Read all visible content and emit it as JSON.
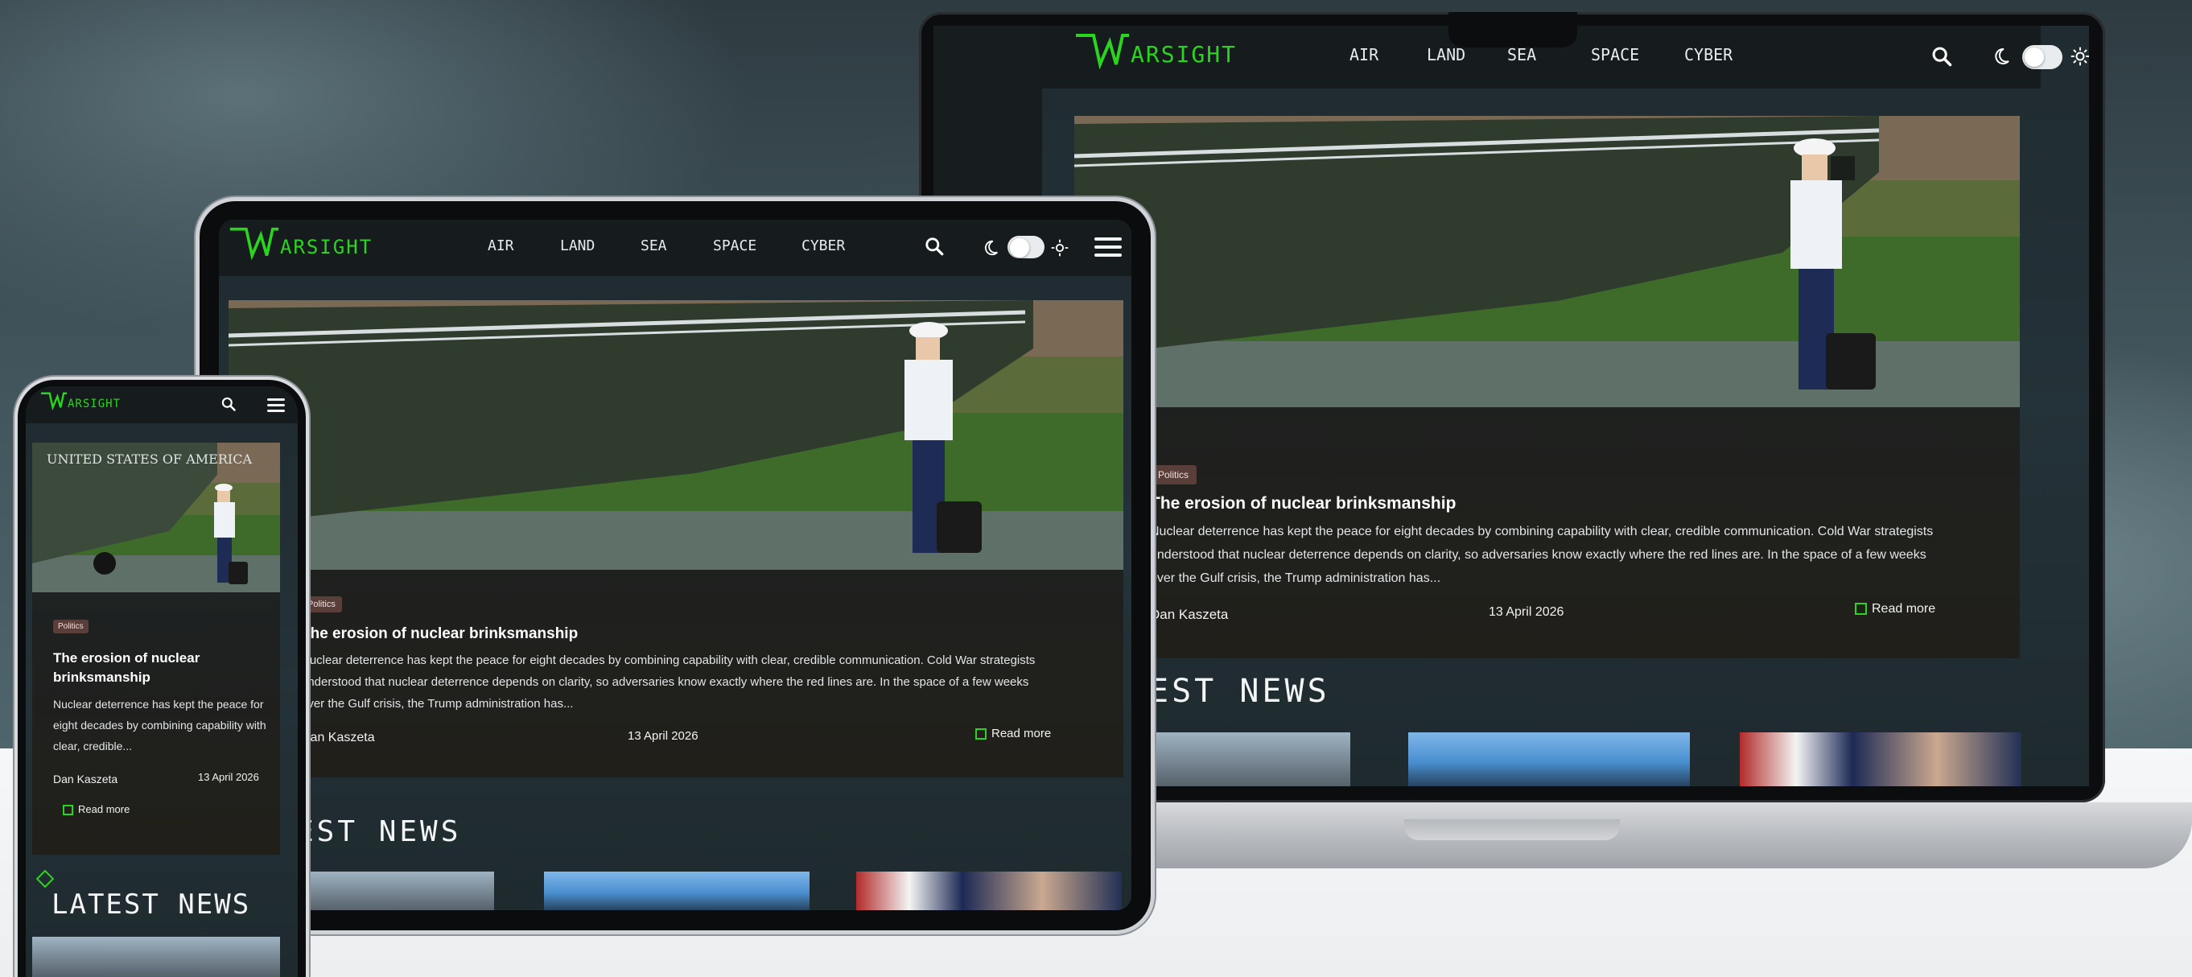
{
  "site": {
    "brand": "ARSIGHT",
    "brand_initial": "W",
    "brand_color": "#2bd51f",
    "nav": [
      "AIR",
      "LAND",
      "SEA",
      "SPACE",
      "CYBER"
    ],
    "icons": {
      "search": "search-icon",
      "moon": "moon-icon",
      "sun": "sun-icon",
      "menu": "hamburger-menu-icon"
    }
  },
  "article": {
    "tag": "Politics",
    "title": "The erosion of nuclear brinksmanship",
    "body": "Nuclear deterrence has kept the peace for eight decades by combining capability with clear, credible communication. Cold War strategists understood that nuclear deterrence depends on clarity, so adversaries know exactly where the red lines are. In the space of a few weeks over the Gulf crisis, the Trump administration has...",
    "body_short": "Nuclear deterrence has kept the peace for eight decades by combining capability with clear, credible...",
    "author": "Dan Kaszeta",
    "date": "13 April 2026",
    "read_more": "Read more"
  },
  "latest_news": {
    "heading": "LATEST NEWS",
    "heading_cropped": "EST NEWS"
  },
  "colors": {
    "accent": "#2bd51f",
    "tag_bg": "#5a3e3a",
    "header_bg": "#161b1d"
  }
}
